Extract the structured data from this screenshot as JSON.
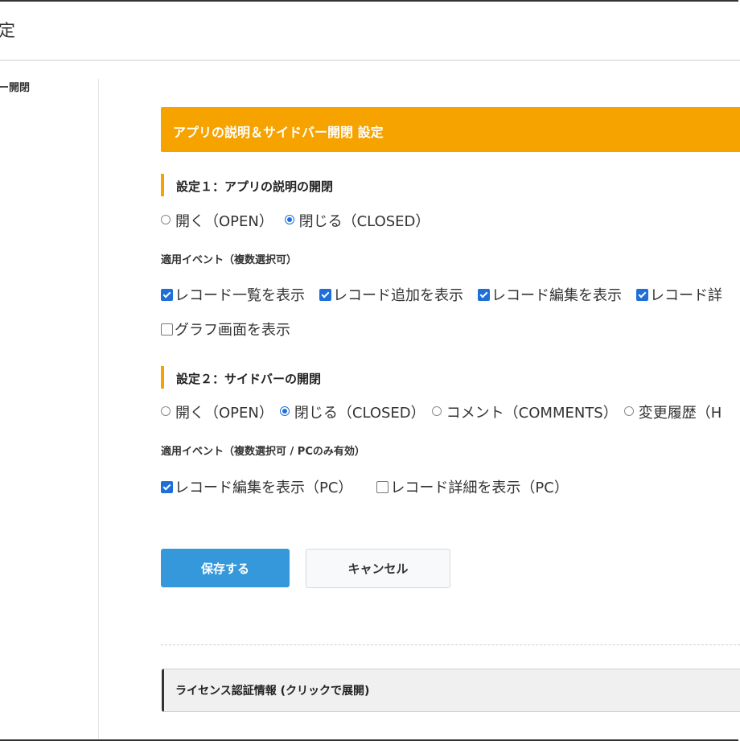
{
  "header": {
    "title": "定"
  },
  "sidebar": {
    "label": "ー開閉"
  },
  "banner": {
    "title": "アプリの説明＆サイドバー開閉 設定"
  },
  "setting1": {
    "heading": "設定１：アプリの説明の開閉",
    "options": [
      {
        "label": "開く（OPEN）",
        "selected": false
      },
      {
        "label": "閉じる（CLOSED）",
        "selected": true
      }
    ],
    "events_label": "適用イベント（複数選択可）",
    "events": [
      {
        "label": "レコード一覧を表示",
        "checked": true
      },
      {
        "label": "レコード追加を表示",
        "checked": true
      },
      {
        "label": "レコード編集を表示",
        "checked": true
      },
      {
        "label": "レコード詳",
        "checked": true
      },
      {
        "label": "グラフ画面を表示",
        "checked": false
      }
    ]
  },
  "setting2": {
    "heading": "設定２：サイドバーの開閉",
    "options": [
      {
        "label": "開く（OPEN）",
        "selected": false
      },
      {
        "label": "閉じる（CLOSED）",
        "selected": true
      },
      {
        "label": "コメント（COMMENTS）",
        "selected": false
      },
      {
        "label": "変更履歴（H",
        "selected": false
      }
    ],
    "events_label": "適用イベント（複数選択可 / PCのみ有効）",
    "events": [
      {
        "label": "レコード編集を表示（PC）",
        "checked": true
      },
      {
        "label": "レコード詳細を表示（PC）",
        "checked": false
      }
    ]
  },
  "actions": {
    "save_label": "保存する",
    "cancel_label": "キャンセル"
  },
  "license": {
    "label": "ライセンス認証情報 (クリックで展開)"
  },
  "colors": {
    "accent": "#f6a300",
    "primary": "#3498db",
    "check": "#1e6fd9"
  }
}
